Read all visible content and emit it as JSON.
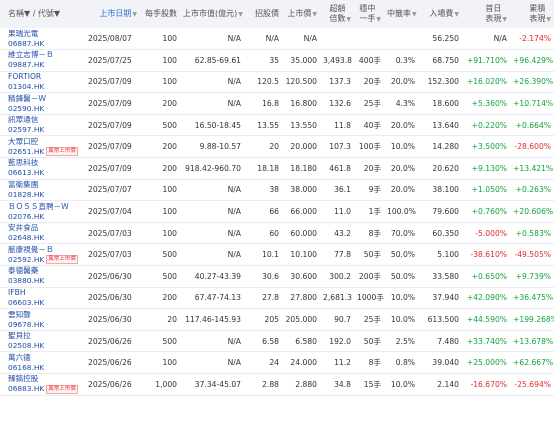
{
  "headers": {
    "name": "名稱▼ / 代號▼",
    "date": "上市日期",
    "lot": "每手股數",
    "mcap": "上市市值(億元)",
    "ipo_price": "招股價",
    "list_price": "上市價",
    "oversub": "超額\n倍數",
    "one_lot": "穩中\n一手",
    "one_lot_rate": "中籤率",
    "cost": "入場費",
    "day1": "首日\n表現",
    "cum": "累積\n表現"
  },
  "rows": [
    {
      "name": "果瑞光電",
      "code": "06887.HK",
      "tag": "",
      "date": "2025/08/07",
      "lot": "100",
      "mcap": "N/A",
      "ipo": "N/A",
      "listp": "N/A",
      "over": "",
      "onelot": "",
      "rate": "",
      "cost": "56.250",
      "day1": "N/A",
      "day1_dir": "",
      "cum": "-2.174%",
      "cum_dir": "dn"
    },
    {
      "name": "維立志博－Ｂ",
      "code": "09887.HK",
      "tag": "",
      "date": "2025/07/25",
      "lot": "100",
      "mcap": "62.85-69.61",
      "ipo": "35",
      "listp": "35.000",
      "over": "3,493.8",
      "onelot": "400手",
      "rate": "0.3%",
      "cost": "68.750",
      "day1": "+91.710%",
      "day1_dir": "up",
      "cum": "+96.429%",
      "cum_dir": "up"
    },
    {
      "name": "FORTIOR",
      "code": "01304.HK",
      "tag": "",
      "date": "2025/07/09",
      "lot": "100",
      "mcap": "N/A",
      "ipo": "120.5",
      "listp": "120.500",
      "over": "137.3",
      "onelot": "20手",
      "rate": "20.0%",
      "cost": "152.300",
      "day1": "+16.020%",
      "day1_dir": "up",
      "cum": "+26.390%",
      "cum_dir": "up"
    },
    {
      "name": "精鋒醫－Ｗ",
      "code": "02590.HK",
      "tag": "",
      "date": "2025/07/09",
      "lot": "200",
      "mcap": "N/A",
      "ipo": "16.8",
      "listp": "16.800",
      "over": "132.6",
      "onelot": "25手",
      "rate": "4.3%",
      "cost": "18.600",
      "day1": "+5.360%",
      "day1_dir": "up",
      "cum": "+10.714%",
      "cum_dir": "up"
    },
    {
      "name": "訊眾通信",
      "code": "02597.HK",
      "tag": "",
      "date": "2025/07/09",
      "lot": "500",
      "mcap": "16.50-18.45",
      "ipo": "13.55",
      "listp": "13.550",
      "over": "11.8",
      "onelot": "40手",
      "rate": "20.0%",
      "cost": "13.640",
      "day1": "+0.220%",
      "day1_dir": "up",
      "cum": "+0.664%",
      "cum_dir": "up"
    },
    {
      "name": "大眾口腔",
      "code": "02651.HK",
      "tag": "異常上市價",
      "date": "2025/07/09",
      "lot": "200",
      "mcap": "9.88-10.57",
      "ipo": "20",
      "listp": "20.000",
      "over": "107.3",
      "onelot": "100手",
      "rate": "10.0%",
      "cost": "14.280",
      "day1": "+3.500%",
      "day1_dir": "up",
      "cum": "-28.600%",
      "cum_dir": "dn"
    },
    {
      "name": "藍思科技",
      "code": "06613.HK",
      "tag": "",
      "date": "2025/07/09",
      "lot": "200",
      "mcap": "918.42-960.70",
      "ipo": "18.18",
      "listp": "18.180",
      "over": "461.8",
      "onelot": "20手",
      "rate": "20.0%",
      "cost": "20.620",
      "day1": "+9.130%",
      "day1_dir": "up",
      "cum": "+13.421%",
      "cum_dir": "up"
    },
    {
      "name": "富衛集團",
      "code": "01828.HK",
      "tag": "",
      "date": "2025/07/07",
      "lot": "100",
      "mcap": "N/A",
      "ipo": "38",
      "listp": "38.000",
      "over": "36.1",
      "onelot": "9手",
      "rate": "20.0%",
      "cost": "38.100",
      "day1": "+1.050%",
      "day1_dir": "up",
      "cum": "+0.263%",
      "cum_dir": "up"
    },
    {
      "name": "ＢＯＳＳ直聘－Ｗ",
      "code": "02076.HK",
      "tag": "",
      "date": "2025/07/04",
      "lot": "100",
      "mcap": "N/A",
      "ipo": "66",
      "listp": "66.000",
      "over": "11.0",
      "onelot": "1手",
      "rate": "100.0%",
      "cost": "79.600",
      "day1": "+0.760%",
      "day1_dir": "up",
      "cum": "+20.606%",
      "cum_dir": "up"
    },
    {
      "name": "安井食品",
      "code": "02648.HK",
      "tag": "",
      "date": "2025/07/03",
      "lot": "100",
      "mcap": "N/A",
      "ipo": "60",
      "listp": "60.000",
      "over": "43.2",
      "onelot": "8手",
      "rate": "70.0%",
      "cost": "60.350",
      "day1": "-5.000%",
      "day1_dir": "dn",
      "cum": "+0.583%",
      "cum_dir": "up"
    },
    {
      "name": "脈康視覺－Ｂ",
      "code": "02592.HK",
      "tag": "異常上市價",
      "date": "2025/07/03",
      "lot": "500",
      "mcap": "N/A",
      "ipo": "10.1",
      "listp": "10.100",
      "over": "77.8",
      "onelot": "50手",
      "rate": "50.0%",
      "cost": "5.100",
      "day1": "-38.610%",
      "day1_dir": "dn",
      "cum": "-49.505%",
      "cum_dir": "dn"
    },
    {
      "name": "泰德醫藥",
      "code": "03880.HK",
      "tag": "",
      "date": "2025/06/30",
      "lot": "500",
      "mcap": "40.27-43.39",
      "ipo": "30.6",
      "listp": "30.600",
      "over": "300.2",
      "onelot": "200手",
      "rate": "50.0%",
      "cost": "33.580",
      "day1": "+0.650%",
      "day1_dir": "up",
      "cum": "+9.739%",
      "cum_dir": "up"
    },
    {
      "name": "IFBH",
      "code": "06603.HK",
      "tag": "",
      "date": "2025/06/30",
      "lot": "200",
      "mcap": "67.47-74.13",
      "ipo": "27.8",
      "listp": "27.800",
      "over": "2,681.3",
      "onelot": "1000手",
      "rate": "10.0%",
      "cost": "37.940",
      "day1": "+42.090%",
      "day1_dir": "up",
      "cum": "+36.475%",
      "cum_dir": "up"
    },
    {
      "name": "雲知聲",
      "code": "09678.HK",
      "tag": "",
      "date": "2025/06/30",
      "lot": "20",
      "mcap": "117.46-145.93",
      "ipo": "205",
      "listp": "205.000",
      "over": "90.7",
      "onelot": "25手",
      "rate": "10.0%",
      "cost": "613.500",
      "day1": "+44.590%",
      "day1_dir": "up",
      "cum": "+199.268%",
      "cum_dir": "up"
    },
    {
      "name": "聖貝拉",
      "code": "02508.HK",
      "tag": "",
      "date": "2025/06/26",
      "lot": "500",
      "mcap": "N/A",
      "ipo": "6.58",
      "listp": "6.580",
      "over": "192.0",
      "onelot": "50手",
      "rate": "2.5%",
      "cost": "7.480",
      "day1": "+33.740%",
      "day1_dir": "up",
      "cum": "+13.678%",
      "cum_dir": "up"
    },
    {
      "name": "萬六德",
      "code": "06168.HK",
      "tag": "",
      "date": "2025/06/26",
      "lot": "100",
      "mcap": "N/A",
      "ipo": "24",
      "listp": "24.000",
      "over": "11.2",
      "onelot": "8手",
      "rate": "0.8%",
      "cost": "39.040",
      "day1": "+25.000%",
      "day1_dir": "up",
      "cum": "+62.667%",
      "cum_dir": "up"
    },
    {
      "name": "臻鎬控股",
      "code": "06883.HK",
      "tag": "異常上市價",
      "date": "2025/06/26",
      "lot": "1,000",
      "mcap": "37.34-45.07",
      "ipo": "2.88",
      "listp": "2.880",
      "over": "34.8",
      "onelot": "15手",
      "rate": "10.0%",
      "cost": "2.140",
      "day1": "-16.670%",
      "day1_dir": "dn",
      "cum": "-25.694%",
      "cum_dir": "dn"
    }
  ],
  "colors": {
    "up": "#12a33c",
    "down": "#e22a2a",
    "link": "#1f4fa8",
    "header_bg": "#f1f3f7"
  }
}
